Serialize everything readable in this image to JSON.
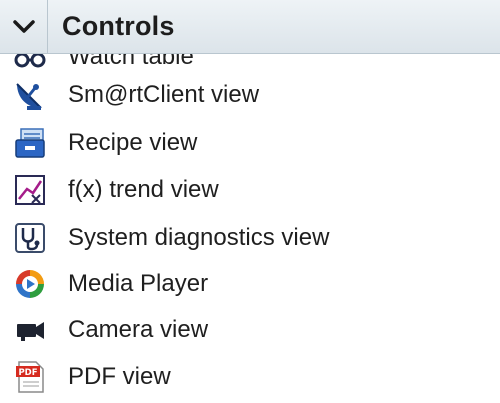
{
  "header": {
    "title": "Controls",
    "toggle_icon": "chevron-down-icon"
  },
  "items": [
    {
      "label": "Watch table",
      "icon": "glasses-icon"
    },
    {
      "label": "Sm@rtClient view",
      "icon": "satellite-dish-icon"
    },
    {
      "label": "Recipe view",
      "icon": "recipe-box-icon"
    },
    {
      "label": "f(x) trend view",
      "icon": "trend-chart-icon"
    },
    {
      "label": "System diagnostics view",
      "icon": "stethoscope-icon"
    },
    {
      "label": "Media Player",
      "icon": "media-player-icon"
    },
    {
      "label": "Camera view",
      "icon": "camera-icon"
    },
    {
      "label": "PDF view",
      "icon": "pdf-icon"
    }
  ]
}
